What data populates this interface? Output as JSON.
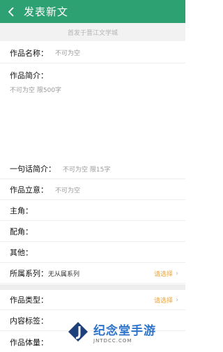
{
  "header": {
    "title": "发表新文",
    "back_icon": "chevron-left-icon"
  },
  "subheader": "首发于晋江文学城",
  "fields": {
    "name_label": "作品名称：",
    "name_placeholder": "不可为空",
    "intro_label": "作品简介：",
    "intro_placeholder": "不可为空 限500字",
    "oneline_label": "一句话简介：",
    "oneline_placeholder": "不可为空 限15字",
    "idea_label": "作品立意：",
    "idea_placeholder": "不可为空",
    "lead_label": "主角：",
    "support_label": "配角：",
    "other_label": "其他：",
    "series_label": "所属系列：",
    "series_value": "无从属系列",
    "series_action": "请选择",
    "type_label": "作品类型：",
    "type_action": "请选择",
    "tags_label": "内容标签：",
    "volume_label": "作品体量："
  },
  "watermark": {
    "main": "纪念堂手游",
    "sub": "JNTDCC.COM"
  },
  "colors": {
    "brand_green": "#2ea173",
    "action_orange": "#e8a33b"
  }
}
